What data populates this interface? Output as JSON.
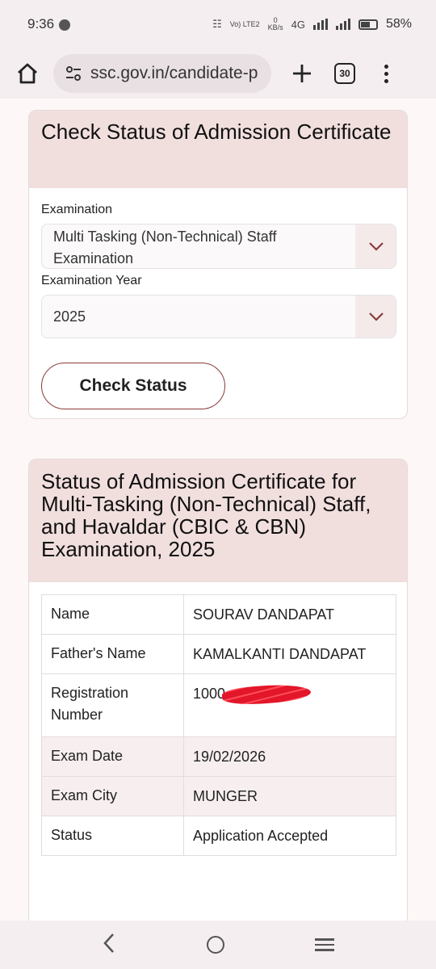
{
  "status_bar": {
    "time": "9:36",
    "volte": "Vo) LTE2",
    "speed_value": "0",
    "speed_unit": "KB/s",
    "network": "4G",
    "battery": "58%"
  },
  "browser": {
    "url": "ssc.gov.in/candidate-p",
    "tab_count": "30"
  },
  "check_card": {
    "title": "Check Status of Admission Certificate",
    "exam_label": "Examination",
    "exam_value": "Multi Tasking (Non-Technical) Staff Examination",
    "year_label": "Examination Year",
    "year_value": "2025",
    "button_label": "Check Status"
  },
  "status_card": {
    "title": "Status of Admission Certificate for Multi-Tasking (Non-Technical) Staff, and Havaldar (CBIC & CBN) Examination, 2025",
    "rows": [
      {
        "key": "Name",
        "value": "SOURAV DANDAPAT"
      },
      {
        "key": "Father's Name",
        "value": "KAMALKANTI DANDAPAT"
      },
      {
        "key": "Registration Number",
        "value": "1000"
      },
      {
        "key": "Exam Date",
        "value": "19/02/2026"
      },
      {
        "key": "Exam City",
        "value": "MUNGER"
      },
      {
        "key": "Status",
        "value": "Application Accepted"
      }
    ]
  },
  "colors": {
    "header_bg": "#f1dfde",
    "button_border": "#8b3a3a",
    "status_green": "#3fb24a"
  }
}
